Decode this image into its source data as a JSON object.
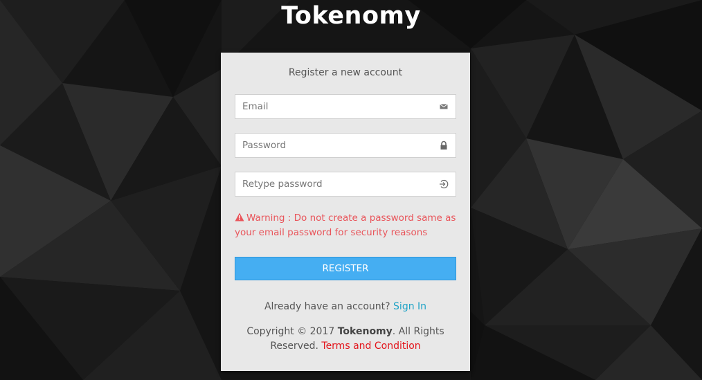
{
  "brand": {
    "title": "Tokenomy"
  },
  "form": {
    "heading": "Register a new account",
    "email": {
      "placeholder": "Email",
      "value": "",
      "icon": "envelope-icon"
    },
    "password": {
      "placeholder": "Password",
      "value": "",
      "icon": "lock-icon"
    },
    "retype_password": {
      "placeholder": "Retype password",
      "value": "",
      "icon": "sign-in-icon"
    },
    "warning": {
      "icon": "warning-triangle-icon",
      "text": "Warning : Do not create a password same as your email password for security reasons"
    },
    "register_label": "REGISTER",
    "signin_prompt": "Already have an account?",
    "signin_link": "Sign In"
  },
  "footer": {
    "copyright_prefix": "Copyright © 2017",
    "brand_name": "Tokenomy",
    "copyright_suffix": ". All Rights Reserved.",
    "terms_link": "Terms and Condition"
  },
  "colors": {
    "background": "#141414",
    "card": "#e8e8e8",
    "accent_button": "#45aef2",
    "warning": "#e9555b",
    "link_signin": "#1fa3c6",
    "link_terms": "#e3141b"
  }
}
